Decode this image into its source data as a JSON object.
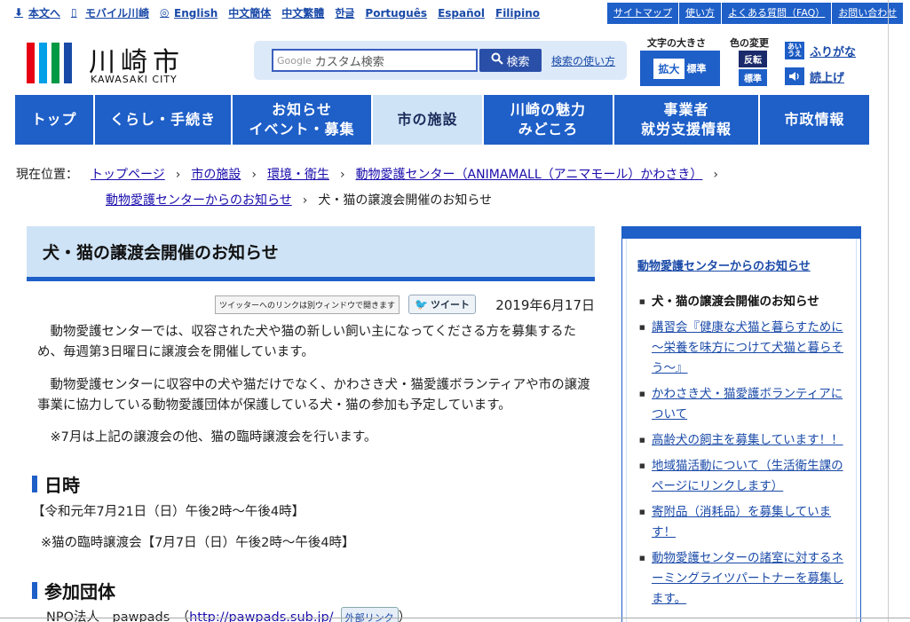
{
  "lang_bar": {
    "items": [
      {
        "label": "本文へ",
        "icon": "download-arrow-icon"
      },
      {
        "label": "モバイル川崎",
        "icon": "mobile-phone-icon"
      },
      {
        "label": "English",
        "icon": "globe-icon"
      },
      {
        "label": "中文簡体"
      },
      {
        "label": "中文繁體"
      },
      {
        "label": "한글"
      },
      {
        "label": "Português"
      },
      {
        "label": "Español"
      },
      {
        "label": "Filipino"
      }
    ]
  },
  "utility_links": [
    "サイトマップ",
    "使い方",
    "よくある質問（FAQ）",
    "お問い合わせ"
  ],
  "logo": {
    "jp": "川崎市",
    "en": "KAWASAKI CITY",
    "bar_colors": [
      "#e60012",
      "#00a0e9",
      "#009944",
      "#1a4aa8"
    ]
  },
  "search": {
    "google_label": "Google",
    "placeholder": "カスタム検索",
    "button": "検索",
    "help": "検索の使い方"
  },
  "text_size": {
    "title": "文字の大きさ",
    "enlarge": "拡大",
    "standard": "標準"
  },
  "color_change": {
    "title": "色の変更",
    "invert": "反転",
    "standard": "標準"
  },
  "tools": {
    "furigana": "ふりがな",
    "furigana_icon": "あい\nうえ",
    "read_aloud": "読上げ"
  },
  "nav": [
    {
      "label": "トップ"
    },
    {
      "label": "くらし・手続き"
    },
    {
      "label": "お知らせ\nイベント・募集"
    },
    {
      "label": "市の施設",
      "active": true
    },
    {
      "label": "川崎の魅力\nみどころ"
    },
    {
      "label": "事業者\n就労支援情報"
    },
    {
      "label": "市政情報"
    }
  ],
  "breadcrumb": {
    "prefix": "現在位置：",
    "links": [
      "トップページ",
      "市の施設",
      "環境・衛生",
      "動物愛護センター（ANIMAMALL（アニマモール）かわさき）",
      "動物愛護センターからのお知らせ"
    ],
    "current": "犬・猫の譲渡会開催のお知らせ"
  },
  "article": {
    "title": "犬・猫の譲渡会開催のお知らせ",
    "twitter_note": "ツイッターへのリンクは別ウィンドウで開きます",
    "tweet": "ツイート",
    "date": "2019年6月17日",
    "p1": "　動物愛護センターでは、収容された犬や猫の新しい飼い主になってくださる方を募集するため、毎週第3日曜日に譲渡会を開催しています。",
    "p2": "　動物愛護センターに収容中の犬や猫だけでなく、かわさき犬・猫愛護ボランティアや市の譲渡事業に協力している動物愛護団体が保護している犬・猫の参加も予定しています。",
    "p3": "　※7月は上記の譲渡会の他、猫の臨時譲渡会を行います。",
    "h_datetime": "日時",
    "dt1": "【令和元年7月21日（日）午後2時～午後4時】",
    "dt2": "※猫の臨時譲渡会【7月7日（日）午後2時～午後4時】",
    "h_groups": "参加団体",
    "group1_prefix": "NPO法人　pawpads　（",
    "group1_url": "http://pawpads.sub.jp/",
    "group1_suffix": "",
    "external_badge": "外部リンク",
    "group1_close": "）"
  },
  "sidebar": {
    "title": "動物愛護センターからのお知らせ",
    "items": [
      {
        "label": "犬・猫の譲渡会開催のお知らせ",
        "current": true
      },
      {
        "label": "講習会『健康な犬猫と暮らすために～栄養を味方につけて犬猫と暮らそう～』"
      },
      {
        "label": "かわさき犬・猫愛護ボランティアについて"
      },
      {
        "label": "高齢犬の飼主を募集しています！！"
      },
      {
        "label": "地域猫活動について（生活衛生課のページにリンクします）"
      },
      {
        "label": "寄附品（消耗品）を募集しています！"
      },
      {
        "label": "動物愛護センターの諸室に対するネーミングライツパートナーを募集します。"
      }
    ]
  }
}
